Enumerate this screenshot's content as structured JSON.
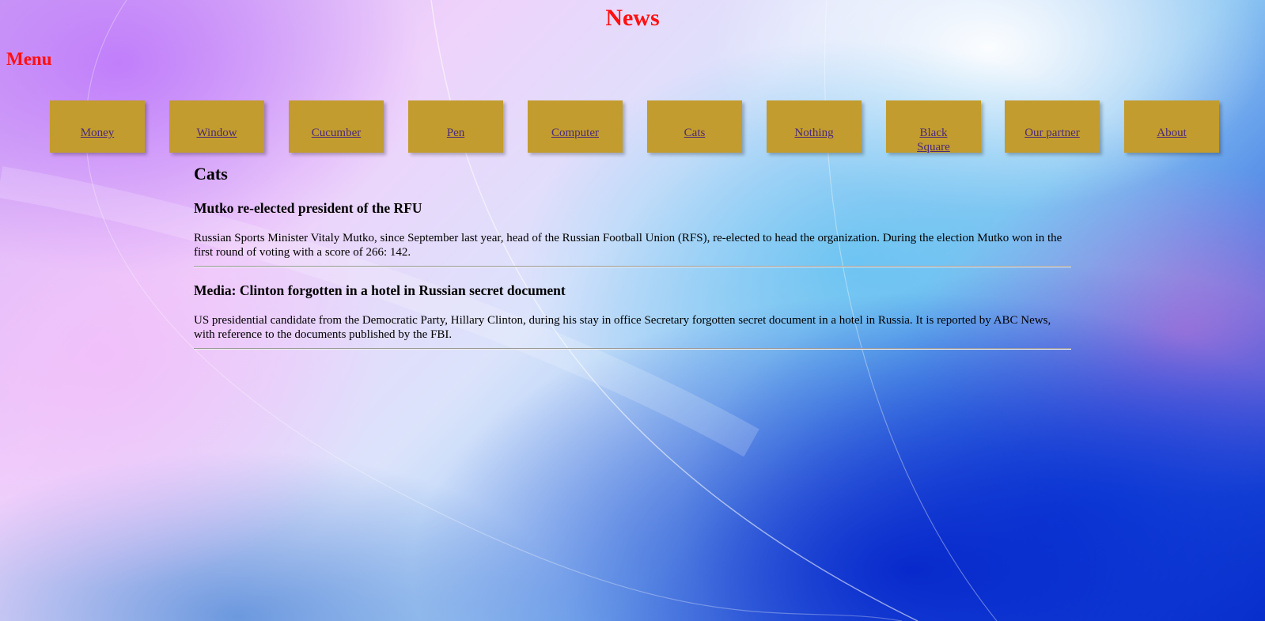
{
  "header": {
    "title": "News",
    "menu_label": "Menu"
  },
  "nav": {
    "items": [
      {
        "label": "Money"
      },
      {
        "label": "Window"
      },
      {
        "label": "Cucumber"
      },
      {
        "label": "Pen"
      },
      {
        "label": "Computer"
      },
      {
        "label": "Cats"
      },
      {
        "label": "Nothing"
      },
      {
        "label": "Black Square"
      },
      {
        "label": "Our partner"
      },
      {
        "label": "About"
      }
    ]
  },
  "main": {
    "section_title": "Cats",
    "articles": [
      {
        "title": "Mutko re-elected president of the RFU",
        "body": "Russian Sports Minister Vitaly Mutko, since September last year, head of the Russian Football Union (RFS), re-elected to head the organization. During the election Mutko won in the first round of voting with a score of 266: 142."
      },
      {
        "title": "Media: Clinton forgotten in a hotel in Russian secret document",
        "body": "US presidential candidate from the Democratic Party, Hillary Clinton, during his stay in office Secretary forgotten secret document in a hotel in Russia. It is reported by ABC News, with reference to the documents published by the FBI."
      }
    ]
  },
  "colors": {
    "heading_red": "#ff1010",
    "nav_tile": "#c29c2e",
    "nav_link": "#4b2a7a"
  }
}
